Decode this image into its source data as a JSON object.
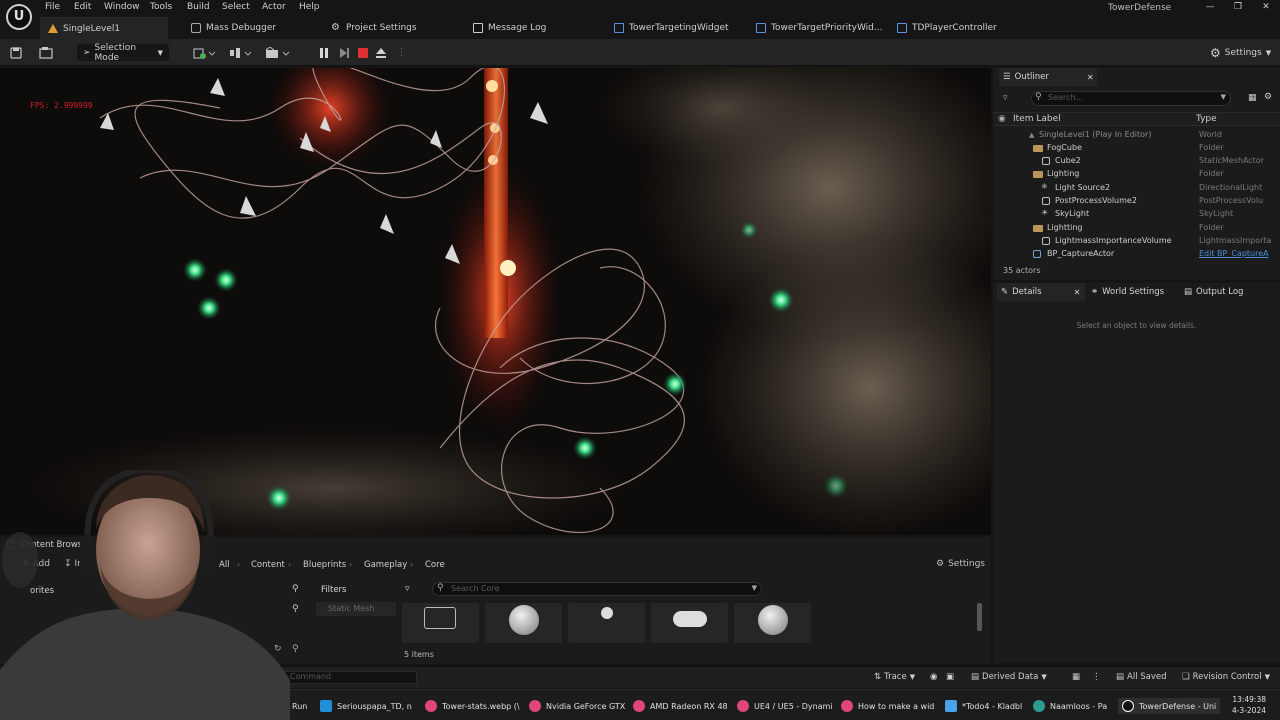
{
  "menubar": {
    "logo": "U",
    "items": [
      "File",
      "Edit",
      "Window",
      "Tools",
      "Build",
      "Select",
      "Actor",
      "Help"
    ],
    "project_name": "TowerDefense"
  },
  "tabs": [
    {
      "label": "SingleLevel1",
      "icon": "level-icon"
    },
    {
      "label": "Mass Debugger",
      "icon": "debugger-icon"
    },
    {
      "label": "Project Settings",
      "icon": "gear-icon"
    },
    {
      "label": "Message Log",
      "icon": "log-icon"
    },
    {
      "label": "TowerTargetingWidget",
      "icon": "widget-icon"
    },
    {
      "label": "TowerTargetPriorityWid...",
      "icon": "widget-icon"
    },
    {
      "label": "TDPlayerController",
      "icon": "controller-icon"
    }
  ],
  "toolbar": {
    "mode_label": "Selection Mode",
    "settings_label": "Settings"
  },
  "viewport": {
    "fps_text": "FPS: 2.999999"
  },
  "outliner": {
    "tab_label": "Outliner",
    "search_placeholder": "Search...",
    "col_label": "Item Label",
    "col_type": "Type",
    "rows": [
      {
        "label": "SingleLevel1 (Play In Editor)",
        "type": "World"
      },
      {
        "label": "FogCube",
        "type": "Folder"
      },
      {
        "label": "Cube2",
        "type": "StaticMeshActor"
      },
      {
        "label": "Lighting",
        "type": "Folder"
      },
      {
        "label": "Light Source2",
        "type": "DirectionalLight"
      },
      {
        "label": "PostProcessVolume2",
        "type": "PostProcessVolu"
      },
      {
        "label": "SkyLight",
        "type": "SkyLight"
      },
      {
        "label": "Lightting",
        "type": "Folder"
      },
      {
        "label": "LightmassImportanceVolume",
        "type": "LightmassImporta"
      },
      {
        "label": "BP_CaptureActor",
        "type": "Edit BP_CaptureA"
      }
    ],
    "actor_count": "35 actors"
  },
  "details": {
    "tabs": [
      "Details",
      "World Settings",
      "Output Log"
    ],
    "empty_text": "Select an object to view details."
  },
  "content_browser": {
    "title": "Content Browser",
    "add_label": "Add",
    "import_label": "In",
    "favorites_label": "orites",
    "breadcrumb": [
      "All",
      "Content",
      "Blueprints",
      "Gameplay",
      "Core"
    ],
    "settings_label": "Settings",
    "filters_label": "Filters",
    "filter_chip": "Static Mesh",
    "search_placeholder": "Search Core",
    "items_count": "5 items"
  },
  "statusbar": {
    "cmd_placeholder": "Command",
    "trace_label": "Trace",
    "derived_data_label": "Derived Data",
    "all_saved_label": "All Saved",
    "revision_label": "Revision Control"
  },
  "taskbar": {
    "items": [
      {
        "label": "Run",
        "color": "#2a2a2a"
      },
      {
        "label": "Seriouspapa_TD, n",
        "color": "#1f8fd6"
      },
      {
        "label": "Tower-stats.webp (\\",
        "color": "#e0457b"
      },
      {
        "label": "Nvidia GeForce GTX",
        "color": "#e0457b"
      },
      {
        "label": "AMD Radeon RX 48",
        "color": "#e0457b"
      },
      {
        "label": "UE4 / UE5 - Dynami",
        "color": "#e0457b"
      },
      {
        "label": "How to make a wid",
        "color": "#e0457b"
      },
      {
        "label": "*Todo4 - Kladbl",
        "color": "#4aa3e8"
      },
      {
        "label": "Naamloos - Pa",
        "color": "#2a9d8f"
      },
      {
        "label": "TowerDefense - Uni",
        "color": "#ffffff"
      }
    ],
    "time": "13:49:38",
    "date": "4-3-2024"
  }
}
